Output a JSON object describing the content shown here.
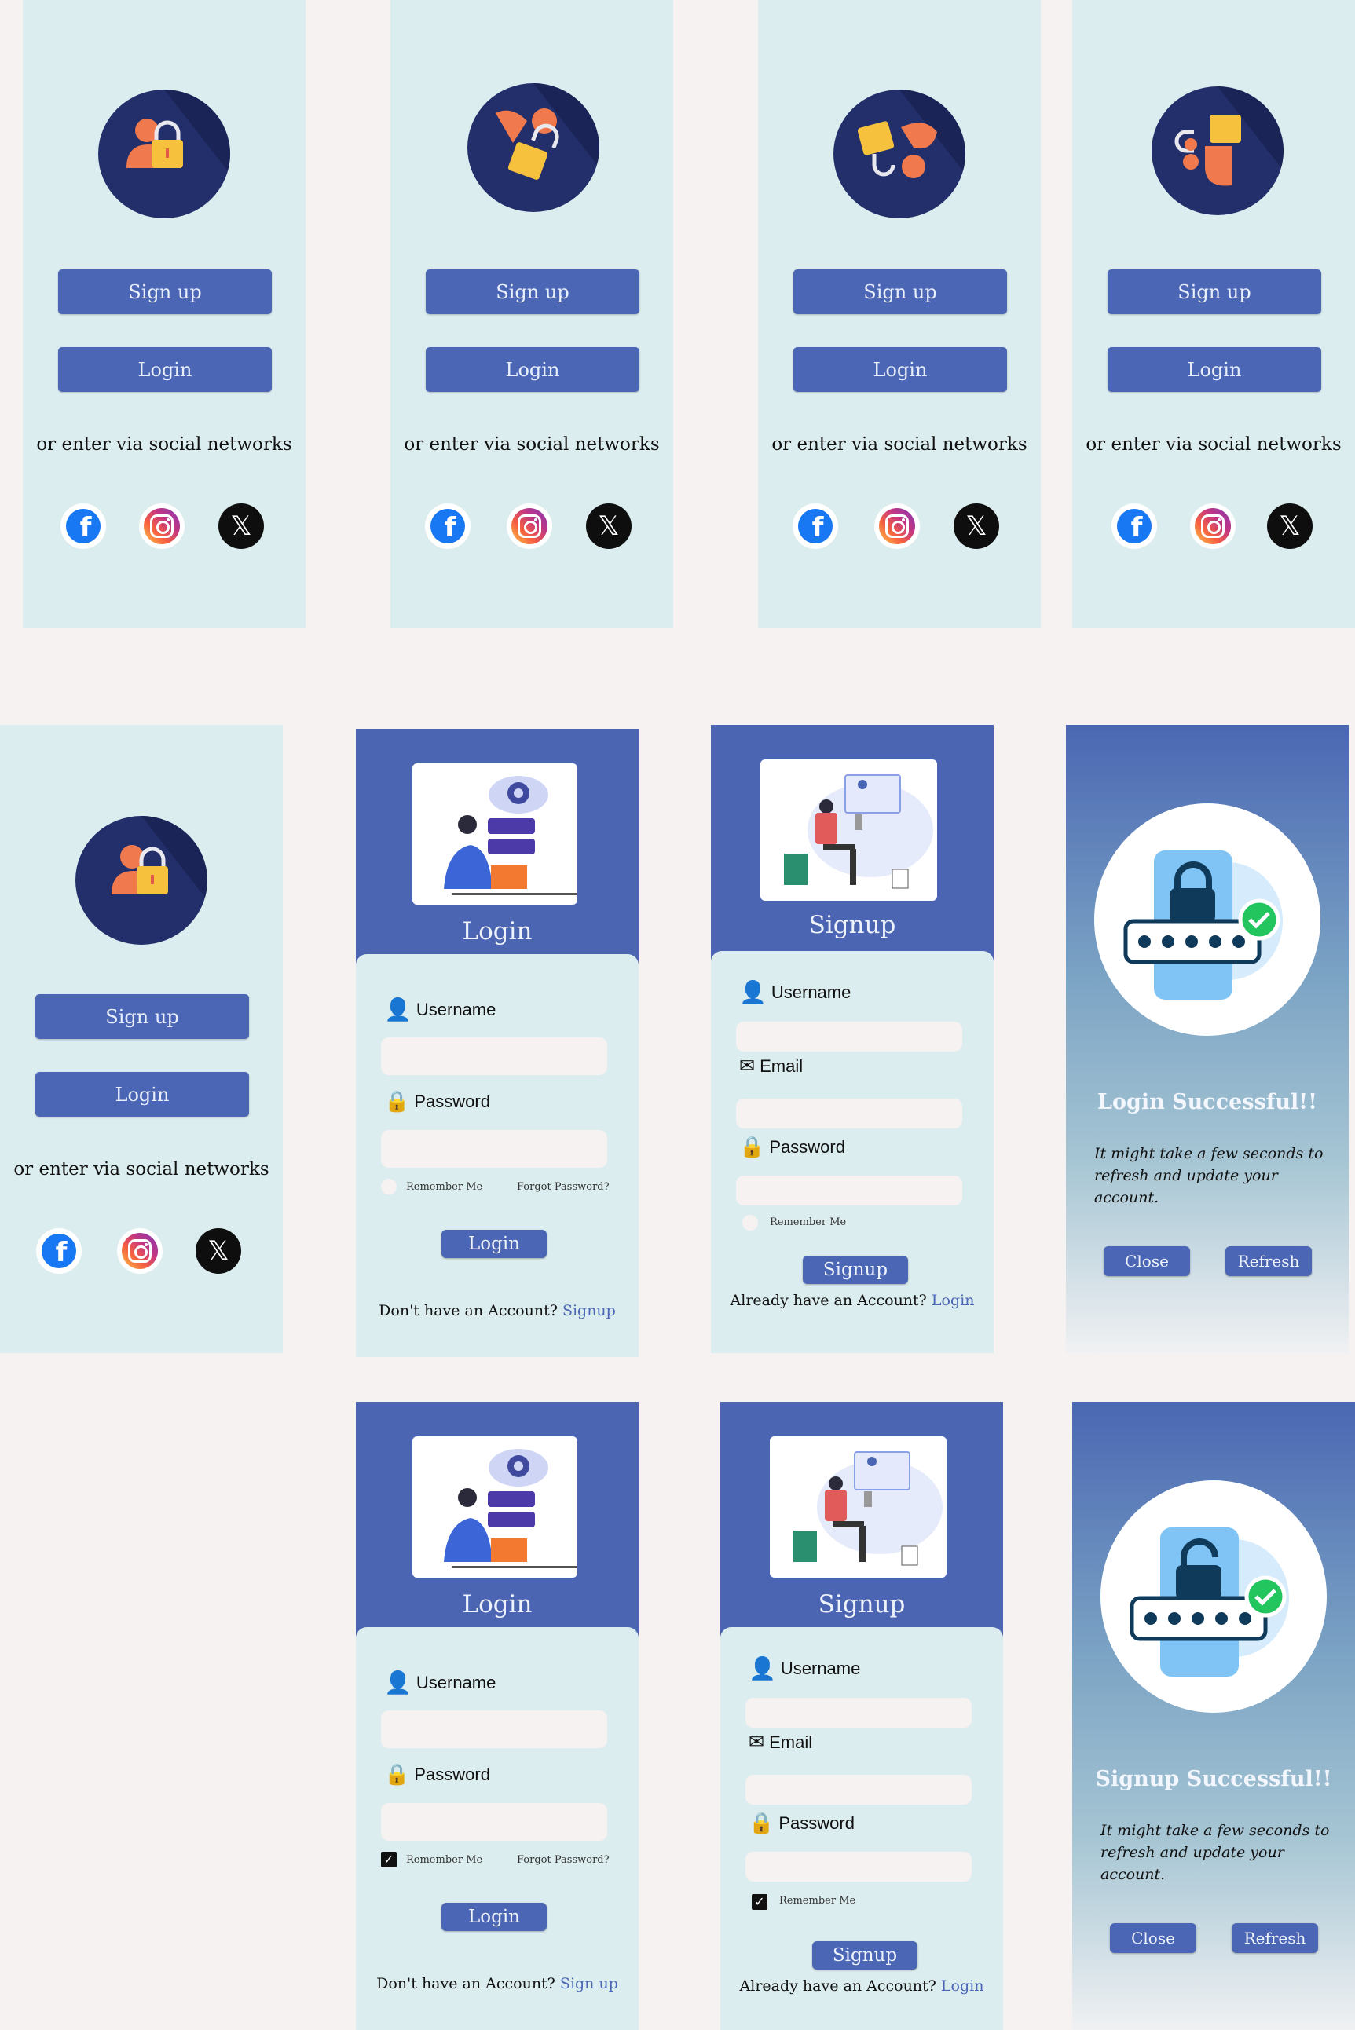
{
  "welcome": {
    "signup_label": "Sign up",
    "login_label": "Login",
    "social_text": "or enter via social networks"
  },
  "login_form": {
    "title": "Login",
    "username_label": "Username",
    "password_label": "Password",
    "remember_label": "Remember Me",
    "forgot_label": "Forgot Password?",
    "submit_label": "Login",
    "bottom_text": "Don't have an Account?",
    "bottom_link": "Signup",
    "bottom_link_alt": "Sign up"
  },
  "signup_form": {
    "title": "Signup",
    "username_label": "Username",
    "email_label": "Email",
    "password_label": "Password",
    "remember_label": "Remember Me",
    "submit_label": "Signup",
    "bottom_text": "Already have an Account?",
    "bottom_link": "Login"
  },
  "success_login": {
    "title": "Login Successful!!",
    "message": "It might take a few seconds to refresh and update your account.",
    "close_label": "Close",
    "refresh_label": "Refresh"
  },
  "success_signup": {
    "title": "Signup Successful!!",
    "message": "It might take a few seconds to refresh and update your account.",
    "close_label": "Close",
    "refresh_label": "Refresh"
  },
  "icons": {
    "facebook": "facebook-icon",
    "instagram": "instagram-icon",
    "x": "x-icon",
    "user": "user-icon",
    "lock": "lock-icon",
    "mail": "mail-icon"
  },
  "colors": {
    "primary": "#4b66b4",
    "panel": "#dcedef",
    "background": "#f6f2f1",
    "hero": "#232f6a",
    "accent_orange": "#f07a4d",
    "accent_yellow": "#f6c23e",
    "success_green": "#22c55e"
  }
}
